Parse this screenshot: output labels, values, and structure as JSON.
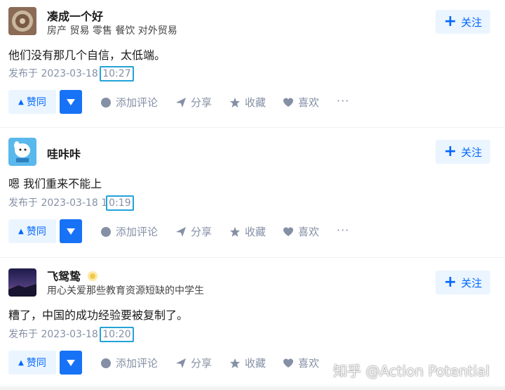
{
  "colors": {
    "accent": "#0066ff",
    "accent_bg": "#ebf5ff",
    "vote_down_bg": "#1772f6",
    "meta": "#8590a6",
    "highlight_box": "#24a2d8"
  },
  "answers": [
    {
      "author": "凑成一个好",
      "bio": "房产 贸易 零售 餐饮 对外贸易",
      "follow_label": "关注",
      "content": "他们没有那几个自信，太低端。",
      "published_prefix": "发布于 2023-03-18 ",
      "published_time": "10:27"
    },
    {
      "author": "哇咔咔",
      "bio": "",
      "follow_label": "关注",
      "content": "嗯 我们重来不能上",
      "published_prefix": "发布于 2023-03-18 1",
      "published_time": "0:19"
    },
    {
      "author": "飞鸳鸷",
      "bio": "用心关爱那些教育资源短缺的中学生",
      "follow_label": "关注",
      "content": "糟了，中国的成功经验要被复制了。",
      "published_prefix": "发布于 2023-03-18 ",
      "published_time": "10:20"
    }
  ],
  "actions": {
    "upvote": "赞同",
    "comment": "添加评论",
    "share": "分享",
    "favorite": "收藏",
    "like": "喜欢",
    "more": "···"
  },
  "watermark": "知乎 @Action Potential"
}
